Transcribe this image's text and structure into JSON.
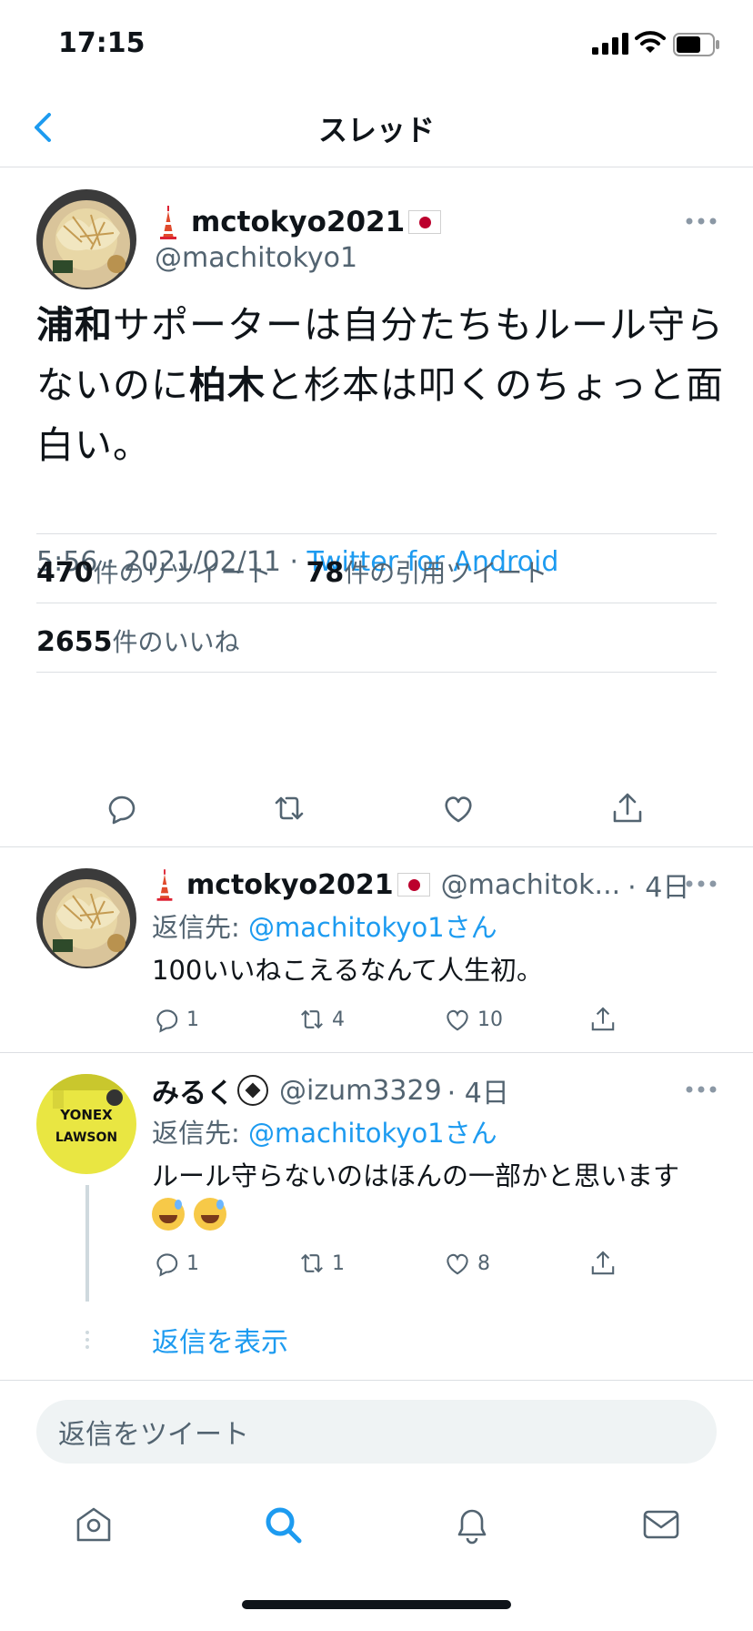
{
  "status_bar": {
    "time": "17:15"
  },
  "nav": {
    "title": "スレッド"
  },
  "main_tweet": {
    "display_name": "mctokyo2021",
    "handle": "@machitokyo1",
    "text_parts": [
      {
        "t": "浦和",
        "b": true
      },
      {
        "t": "サポーターは自分たちもルール守らないのに",
        "b": false
      },
      {
        "t": "柏木",
        "b": true
      },
      {
        "t": "と杉本は叩くのちょっと面白い。",
        "b": false
      }
    ],
    "time": "5:56",
    "date": "2021/02/11",
    "source": "Twitter for Android",
    "retweets_count": "470",
    "retweets_label": "件のリツイート",
    "quotes_count": "78",
    "quotes_label": "件の引用ツイート",
    "likes_count": "2655",
    "likes_label": "件のいいね"
  },
  "replies": [
    {
      "display_name": "mctokyo2021",
      "handle": "@machitok...",
      "age": "· 4日",
      "reply_to_label": "返信先: ",
      "reply_to_handle": "@machitokyo1さん",
      "text": "100いいねこえるなんて人生初。",
      "reply_count": "1",
      "retweet_count": "4",
      "like_count": "10"
    },
    {
      "display_name": "みるく",
      "handle": "@izum3329",
      "age": "· 4日",
      "reply_to_label": "返信先: ",
      "reply_to_handle": "@machitokyo1さん",
      "text": "ルール守らないのはほんの一部かと思います",
      "reply_count": "1",
      "retweet_count": "1",
      "like_count": "8",
      "avatar_text_1": "YONEX",
      "avatar_text_2": "LAWSON"
    }
  ],
  "show_replies": "返信を表示",
  "compose": {
    "placeholder": "返信をツイート"
  },
  "colors": {
    "accent": "#1d9bf0",
    "secondary_text": "#536471",
    "divider": "#dcdfe3"
  }
}
